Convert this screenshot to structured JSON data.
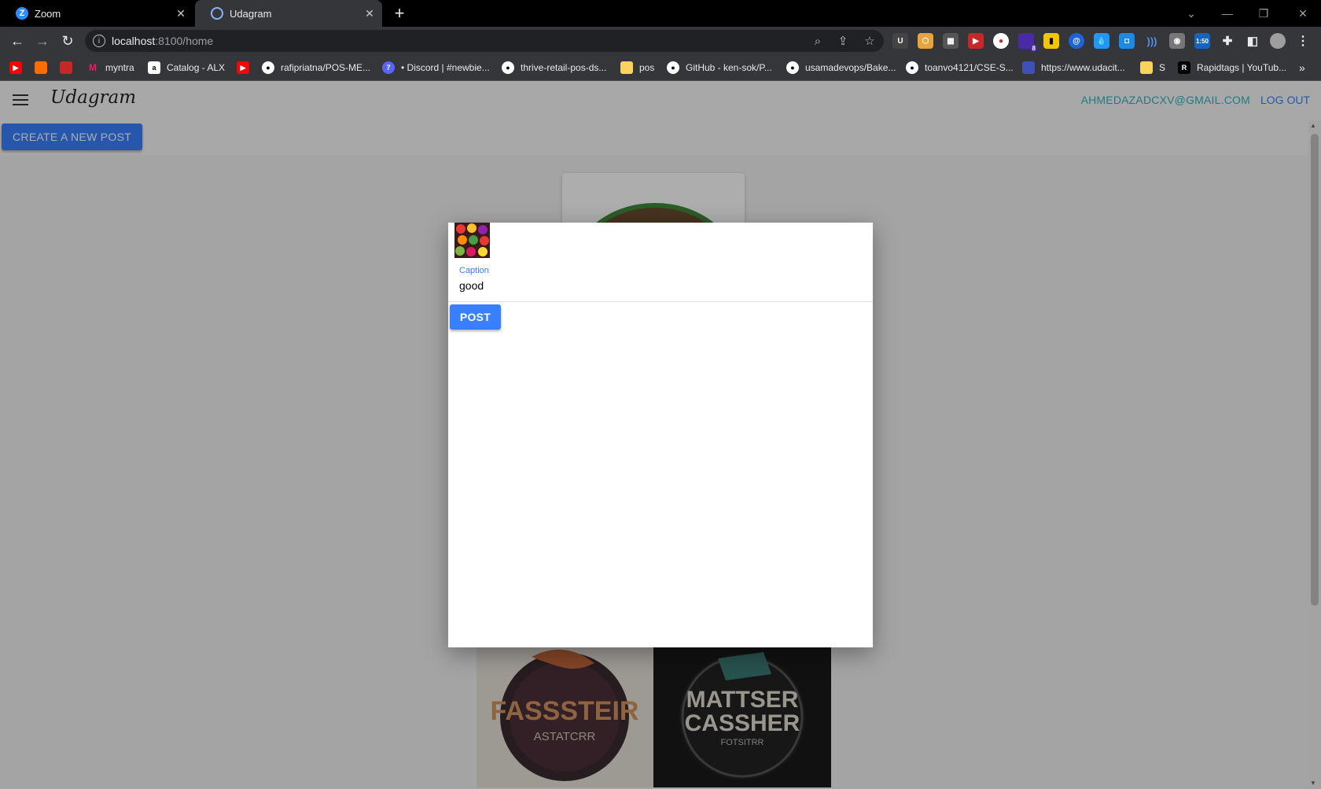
{
  "browser": {
    "tabs": [
      {
        "label": "Zoom",
        "icon": "zoom-icon",
        "active": false
      },
      {
        "label": "Udagram",
        "icon": "globe-icon",
        "active": true
      }
    ],
    "address": {
      "host": "localhost",
      "path": ":8100/home"
    },
    "extension_badges": {
      "count": "8",
      "timer": "1:50"
    },
    "bookmarks": [
      {
        "label": "",
        "icon": "youtube-icon",
        "color": "#ff0000"
      },
      {
        "label": "",
        "icon": "orange-square-icon",
        "color": "#ff6d00"
      },
      {
        "label": "",
        "icon": "red-docs-icon",
        "color": "#c62828"
      },
      {
        "label": "myntra",
        "icon": "myntra-icon",
        "color": "#e91e63"
      },
      {
        "label": "Catalog - ALX",
        "icon": "alx-icon",
        "color": "#ffffff"
      },
      {
        "label": "",
        "icon": "youtube-icon",
        "color": "#ff0000"
      },
      {
        "label": "rafipriatna/POS-ME...",
        "icon": "github-icon",
        "color": "#ffffff"
      },
      {
        "label": "• Discord | #newbie...",
        "icon": "discord-icon",
        "color": "#5865f2"
      },
      {
        "label": "thrive-retail-pos-ds...",
        "icon": "github-icon",
        "color": "#ffffff"
      },
      {
        "label": "pos",
        "icon": "folder-icon",
        "color": "#f9d35b"
      },
      {
        "label": "GitHub - ken-sok/P...",
        "icon": "github-icon",
        "color": "#ffffff"
      },
      {
        "label": "usamadevops/Bake...",
        "icon": "github-icon",
        "color": "#ffffff"
      },
      {
        "label": "toanvo4121/CSE-S...",
        "icon": "github-icon",
        "color": "#ffffff"
      },
      {
        "label": "https://www.udacit...",
        "icon": "udacity-icon",
        "color": "#3f51b5"
      },
      {
        "label": "S",
        "icon": "folder-icon",
        "color": "#f9d35b"
      },
      {
        "label": "Rapidtags | YouTub...",
        "icon": "rapidtags-icon",
        "color": "#000000"
      }
    ],
    "more_bookmarks": "»"
  },
  "app": {
    "logo": "Udagram",
    "user_email": "AHMEDAZADCXV@GMAIL.COM",
    "logout_label": "LOG OUT",
    "create_post_label": "CREATE A NEW POST",
    "accent_color": "#3880ff",
    "email_color": "#2fb5c2"
  },
  "background_feed": {
    "left_image_text": [
      "FASSSTEIR",
      "ASTATCRR"
    ],
    "right_image_text": [
      "MATTSER",
      "CASSHER",
      "FOTSITRR"
    ]
  },
  "modal": {
    "caption_label": "Caption",
    "caption_value": "good",
    "post_label": "POST"
  }
}
